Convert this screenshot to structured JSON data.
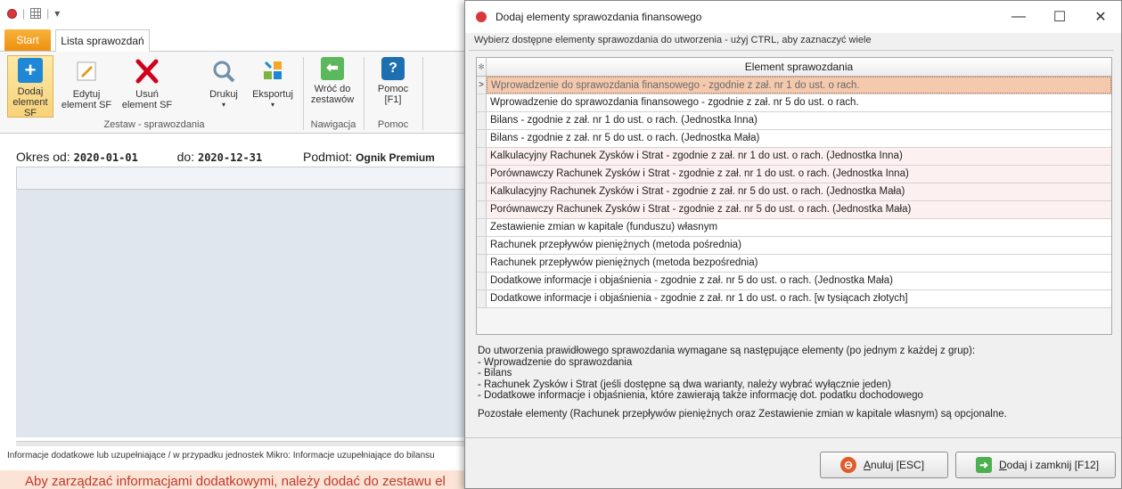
{
  "app": {
    "tabs": {
      "start": "Start",
      "lista": "Lista sprawozdań"
    },
    "ribbon": {
      "buttons": [
        {
          "label1": "Dodaj",
          "label2": "element SF",
          "icon": "add-icon",
          "color": "#1e88d6"
        },
        {
          "label1": "Edytuj",
          "label2": "element SF",
          "icon": "edit-icon",
          "color": "#f0c030"
        },
        {
          "label1": "Usuń",
          "label2": "element SF",
          "icon": "delete-icon",
          "color": "#d0021b"
        },
        {
          "label1": "Drukuj",
          "label2": "▾",
          "icon": "print-icon",
          "color": "#6f8fa8"
        },
        {
          "label1": "Eksportuj",
          "label2": "▾",
          "icon": "export-icon",
          "color": "#7cb342"
        },
        {
          "label1": "Wróć do",
          "label2": "zestawów",
          "icon": "back-arrow-icon",
          "color": "#5cb85c"
        },
        {
          "label1": "Pomoc",
          "label2": "[F1]",
          "icon": "help-icon",
          "color": "#1e6fb0"
        }
      ],
      "groups": {
        "zestaw": "Zestaw - sprawozdania",
        "nawigacja": "Nawigacja",
        "pomoc": "Pomoc"
      }
    },
    "period": {
      "from_label": "Okres od:",
      "from": "2020-01-01",
      "to_label": "do:",
      "to": "2020-12-31",
      "subject_label": "Podmiot:",
      "subject": "Ognik Premium"
    },
    "info_label": "Informacje dodatkowe lub uzupełniające / w przypadku jednostek Mikro: Informacje uzupełniające do bilansu",
    "info_warning": "Aby zarządzać informacjami dodatkowymi, należy dodać do zestawu el"
  },
  "dialog": {
    "title": "Dodaj elementy sprawozdania finansowego",
    "hint": "Wybierz dostępne elementy sprawozdania do utworzenia - użyj CTRL, aby zaznaczyć wiele",
    "column_header": "Element sprawozdania",
    "selector_header": "✻",
    "rows": [
      "Wprowadzenie do sprawozdania finansowego - zgodnie z zał. nr 1 do ust. o rach.",
      "Wprowadzenie do sprawozdania finansowego - zgodnie z zał. nr 5 do ust. o rach.",
      "Bilans - zgodnie z zał. nr 1 do ust. o rach. (Jednostka Inna)",
      "Bilans - zgodnie z zał. nr 5 do ust. o rach. (Jednostka Mała)",
      "Kalkulacyjny Rachunek Zysków i Strat - zgodnie z zał. nr 1 do ust. o rach. (Jednostka Inna)",
      "Porównawczy Rachunek Zysków i Strat - zgodnie z zał. nr 1 do ust. o rach. (Jednostka Inna)",
      "Kalkulacyjny Rachunek Zysków i Strat - zgodnie z zał. nr 5 do ust. o rach. (Jednostka Mała)",
      "Porównawczy Rachunek Zysków i Strat - zgodnie z zał. nr 5 do ust. o rach. (Jednostka Mała)",
      "Zestawienie zmian w kapitale (funduszu) własnym",
      "Rachunek przepływów pieniężnych (metoda pośrednia)",
      "Rachunek przepływów pieniężnych (metoda bezpośrednia)",
      "Dodatkowe informacje i objaśnienia - zgodnie z zał. nr 5 do ust. o rach. (Jednostka Mała)",
      "Dodatkowe informacje i objaśnienia - zgodnie z zał. nr 1 do ust. o rach. [w tysiącach złotych]"
    ],
    "selected_row_marker": ">",
    "notes": [
      "Do utworzenia prawidłowego sprawozdania wymagane są następujące elementy (po jednym z każdej z grup):",
      "- Wprowadzenie do sprawozdania",
      "- Bilans",
      "- Rachunek Zysków i Strat (jeśli dostępne są dwa warianty, należy wybrać wyłącznie jeden)",
      "- Dodatkowe informacje i objaśnienia, które zawierają także informację dot. podatku dochodowego"
    ],
    "notes_optional": "Pozostałe elementy (Rachunek przepływów pieniężnych oraz Zestawienie zmian w kapitale własnym) są opcjonalne.",
    "cancel_button": {
      "underlined": "A",
      "rest": "nuluj [ESC]"
    },
    "ok_button": {
      "underlined": "D",
      "rest": "odaj i zamknij [F12]"
    },
    "window_controls": {
      "minimize": "—",
      "maximize": "☐",
      "close": "✕"
    }
  }
}
